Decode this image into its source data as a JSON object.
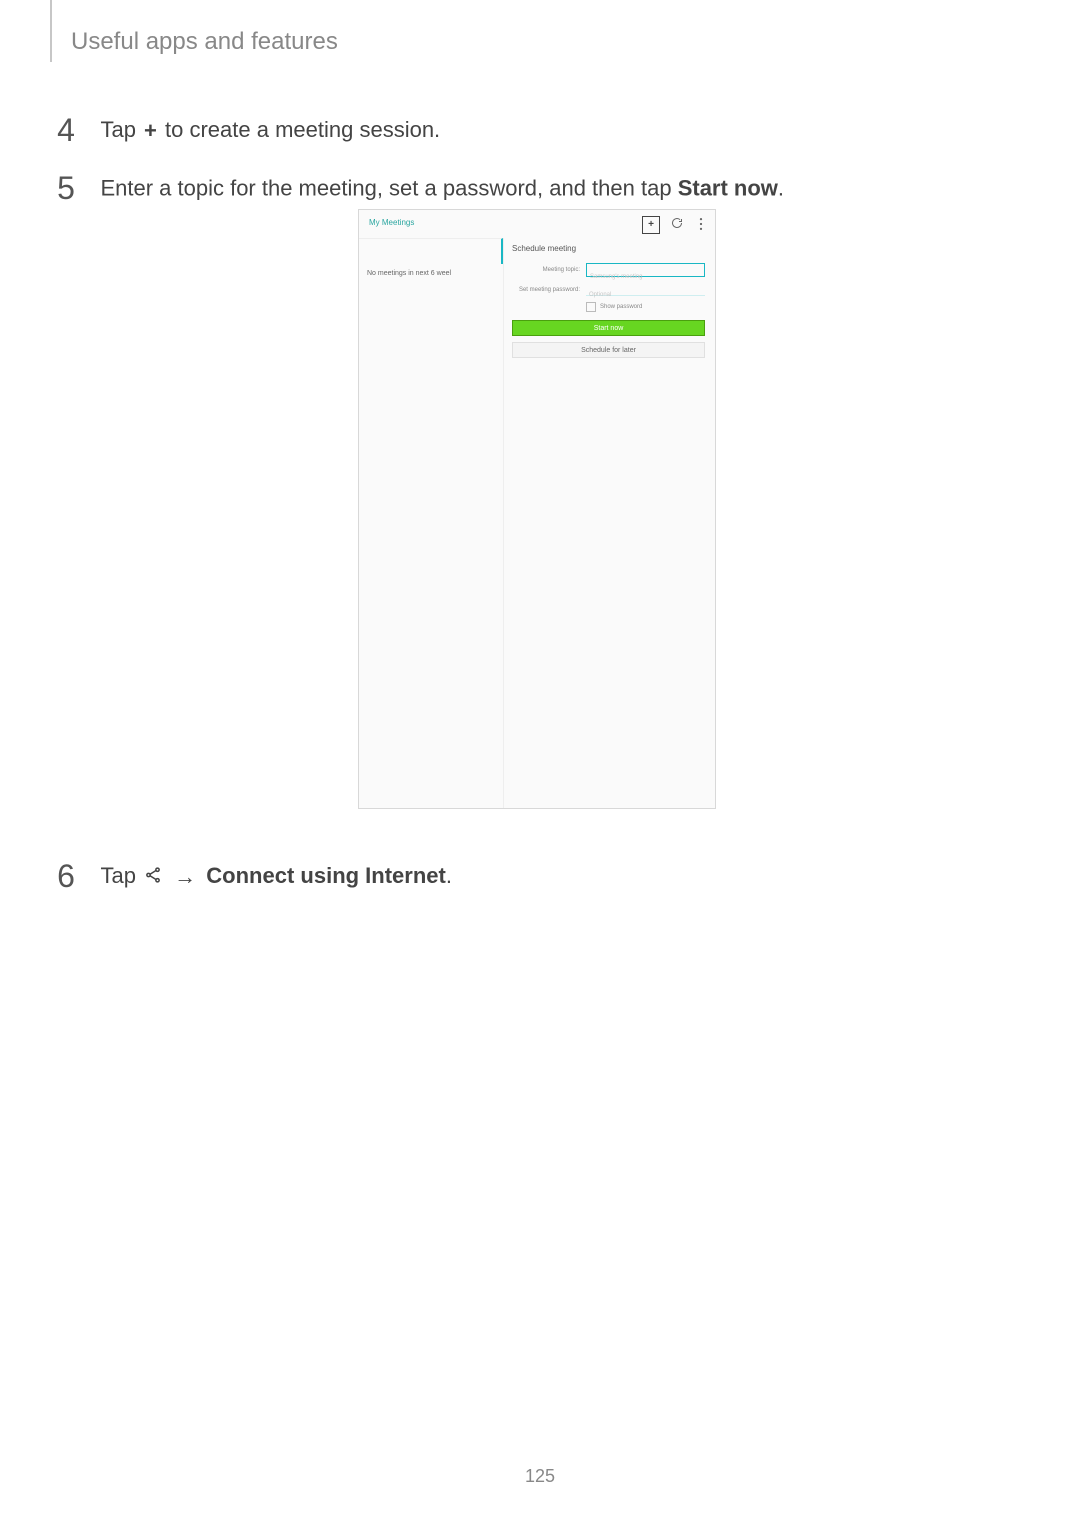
{
  "header": "Useful apps and features",
  "steps": {
    "s4": {
      "num": "4",
      "pre": "Tap ",
      "post": " to create a meeting session."
    },
    "s5": {
      "num": "5",
      "pre": "Enter a topic for the meeting, set a password, and then tap ",
      "bold": "Start now",
      "post": "."
    },
    "s6": {
      "num": "6",
      "pre": "Tap ",
      "arrow": "→",
      "bold": "Connect using Internet",
      "post": "."
    }
  },
  "screenshot": {
    "title": "My Meetings",
    "sidebar_msg": "No meetings in next 6 weel",
    "panel_title": "Schedule meeting",
    "topic_label": "Meeting topic:",
    "topic_placeholder": "Samsung's meeting",
    "pw_label": "Set meeting password:",
    "pw_placeholder": "Optional",
    "show_pw": "Show password",
    "start_btn": "Start now",
    "later_btn": "Schedule for later"
  },
  "page_num": "125"
}
